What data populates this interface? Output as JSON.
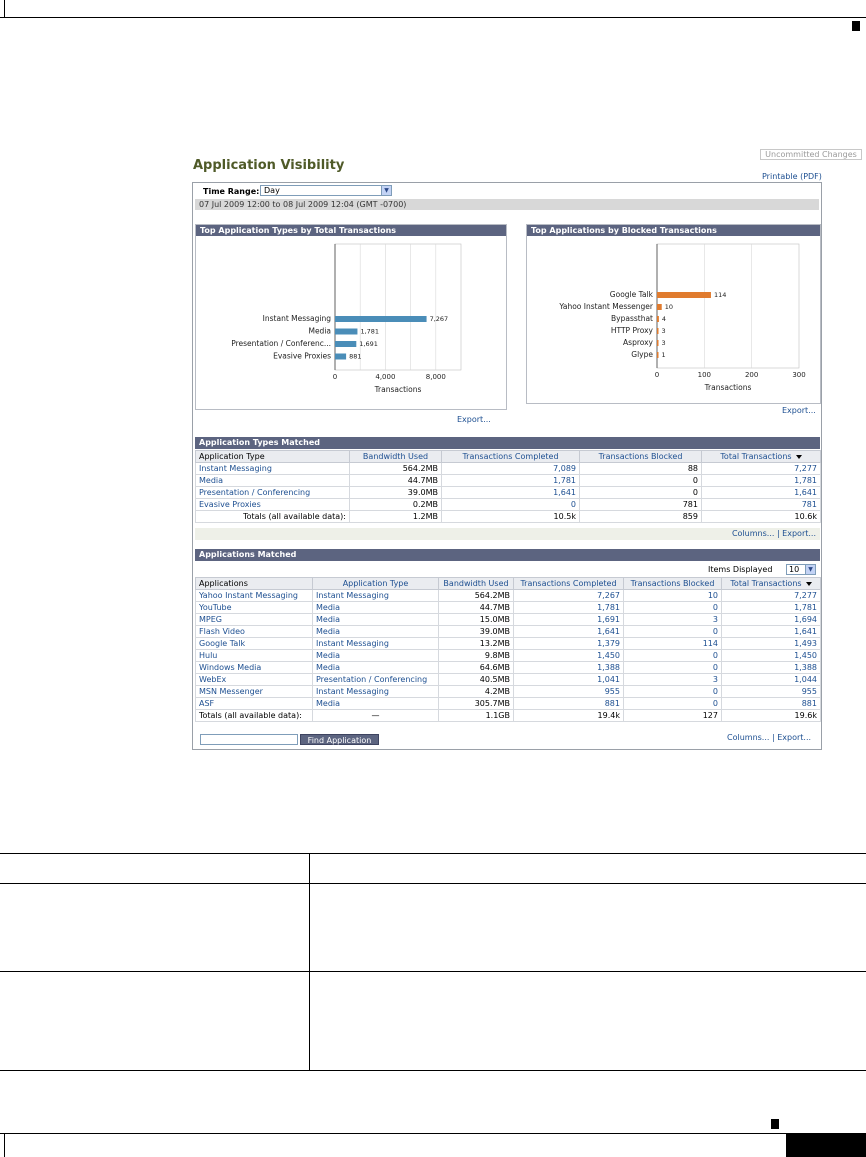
{
  "header": {
    "uncommitted_changes": "Uncommitted Changes",
    "title": "Application Visibility",
    "printable_link": "Printable (PDF)"
  },
  "time_range": {
    "label": "Time Range:",
    "value": "Day",
    "dates": "07 Jul 2009 12:00 to 08 Jul 2009 12:04 (GMT -0700)"
  },
  "chart_data": [
    {
      "type": "bar",
      "orientation": "horizontal",
      "title": "Top Application Types by Total Transactions",
      "categories": [
        "Instant Messaging",
        "Media",
        "Presentation / Conferenc...",
        "Evasive Proxies"
      ],
      "values": [
        7267,
        1781,
        1691,
        881
      ],
      "value_labels": [
        "7,267",
        "1,781",
        "1,691",
        "881"
      ],
      "xlabel": "Transactions",
      "xlim": [
        0,
        10000
      ],
      "ticks": [
        0,
        4000,
        8000
      ],
      "tick_labels": [
        "0",
        "4,000",
        "8,000"
      ],
      "grid": true,
      "color": "#4a8db8"
    },
    {
      "type": "bar",
      "orientation": "horizontal",
      "title": "Top Applications by Blocked Transactions",
      "categories": [
        "Google Talk",
        "Yahoo Instant Messenger",
        "Bypassthat",
        "HTTP Proxy",
        "Asproxy",
        "Glype"
      ],
      "values": [
        114,
        10,
        4,
        3,
        3,
        1
      ],
      "value_labels": [
        "114",
        "10",
        "4",
        "3",
        "3",
        "1"
      ],
      "xlabel": "Transactions",
      "xlim": [
        0,
        300
      ],
      "ticks": [
        0,
        100,
        200,
        300
      ],
      "tick_labels": [
        "0",
        "100",
        "200",
        "300"
      ],
      "grid": true,
      "color": "#e07b2e"
    }
  ],
  "charts_export": [
    "Export...",
    "Export..."
  ],
  "app_types": {
    "section_title": "Application Types Matched",
    "columns": [
      "Application Type",
      "Bandwidth Used",
      "Transactions Completed",
      "Transactions Blocked",
      "Total Transactions"
    ],
    "rows": [
      [
        "Instant Messaging",
        "564.2MB",
        "7,089",
        "88",
        "7,277"
      ],
      [
        "Media",
        "44.7MB",
        "1,781",
        "0",
        "1,781"
      ],
      [
        "Presentation / Conferencing",
        "39.0MB",
        "1,641",
        "0",
        "1,641"
      ],
      [
        "Evasive Proxies",
        "0.2MB",
        "0",
        "781",
        "781"
      ]
    ],
    "totals": [
      "Totals (all available data):",
      "1.2MB",
      "10.5k",
      "859",
      "10.6k"
    ],
    "footer": "Columns... | Export..."
  },
  "apps": {
    "section_title": "Applications Matched",
    "items_displayed_label": "Items Displayed",
    "items_displayed_value": "10",
    "columns": [
      "Applications",
      "Application Type",
      "Bandwidth Used",
      "Transactions Completed",
      "Transactions Blocked",
      "Total Transactions"
    ],
    "rows": [
      [
        "Yahoo Instant Messaging",
        "Instant Messaging",
        "564.2MB",
        "7,267",
        "10",
        "7,277"
      ],
      [
        "YouTube",
        "Media",
        "44.7MB",
        "1,781",
        "0",
        "1,781"
      ],
      [
        "MPEG",
        "Media",
        "15.0MB",
        "1,691",
        "3",
        "1,694"
      ],
      [
        "Flash Video",
        "Media",
        "39.0MB",
        "1,641",
        "0",
        "1,641"
      ],
      [
        "Google Talk",
        "Instant Messaging",
        "13.2MB",
        "1,379",
        "114",
        "1,493"
      ],
      [
        "Hulu",
        "Media",
        "9.8MB",
        "1,450",
        "0",
        "1,450"
      ],
      [
        "Windows Media",
        "Media",
        "64.6MB",
        "1,388",
        "0",
        "1,388"
      ],
      [
        "WebEx",
        "Presentation / Conferencing",
        "40.5MB",
        "1,041",
        "3",
        "1,044"
      ],
      [
        "MSN Messenger",
        "Instant Messaging",
        "4.2MB",
        "955",
        "0",
        "955"
      ],
      [
        "ASF",
        "Media",
        "305.7MB",
        "881",
        "0",
        "881"
      ]
    ],
    "totals": [
      "Totals (all available data):",
      "—",
      "1.1GB",
      "19.4k",
      "127",
      "19.6k"
    ],
    "find_button": "Find Application",
    "footer": "Columns... | Export..."
  }
}
